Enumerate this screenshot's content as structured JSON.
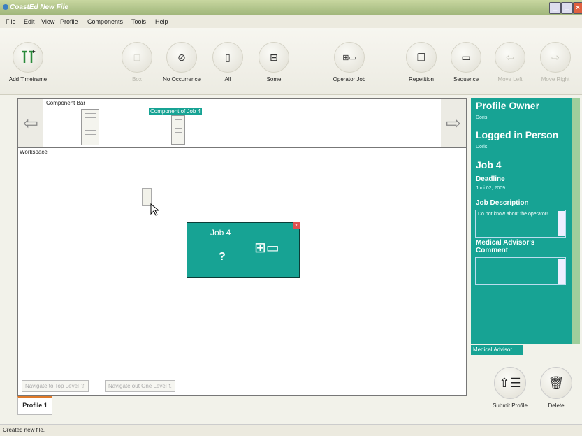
{
  "window": {
    "title": "CoastEd   New File"
  },
  "menu": [
    "File",
    "Edit",
    "View",
    "Profile",
    "Components",
    "Tools",
    "Help"
  ],
  "toolbar": {
    "add_timeframe": "Add Timeframe",
    "box": "Box",
    "no_occurrence": "No Occurrence",
    "all": "All",
    "some": "Some",
    "operator_job": "Operator Job",
    "repetition": "Repetition",
    "sequence": "Sequence",
    "move_left": "Move Left",
    "move_right": "Move Right"
  },
  "component_bar": {
    "label": "Component Bar",
    "selected_label": "Component of Job 4"
  },
  "workspace": {
    "label": "Workspace",
    "job": {
      "title": "Job 4",
      "mark": "?"
    },
    "nav_top": "Navigate to Top Level",
    "nav_up": "Navigate out One Level"
  },
  "tabs": {
    "profile": "Profile 1"
  },
  "right_panel": {
    "profile_owner_label": "Profile Owner",
    "profile_owner": "Doris",
    "logged_in_label": "Logged in Person",
    "logged_in": "Doris",
    "job_title": "Job 4",
    "deadline_label": "Deadline",
    "deadline": "Juni 02, 2009",
    "job_description_label": "Job Description",
    "job_description": "Do not know about the operator!",
    "medical_comment_label": "Medical Advisor's Comment",
    "medical_comment": "",
    "tab": "Medical Advisor"
  },
  "actions": {
    "submit": "Submit Profile",
    "delete": "Delete"
  },
  "status": "Created new file.",
  "colors": {
    "teal": "#17a394",
    "titlebar": "#9fb57a"
  }
}
